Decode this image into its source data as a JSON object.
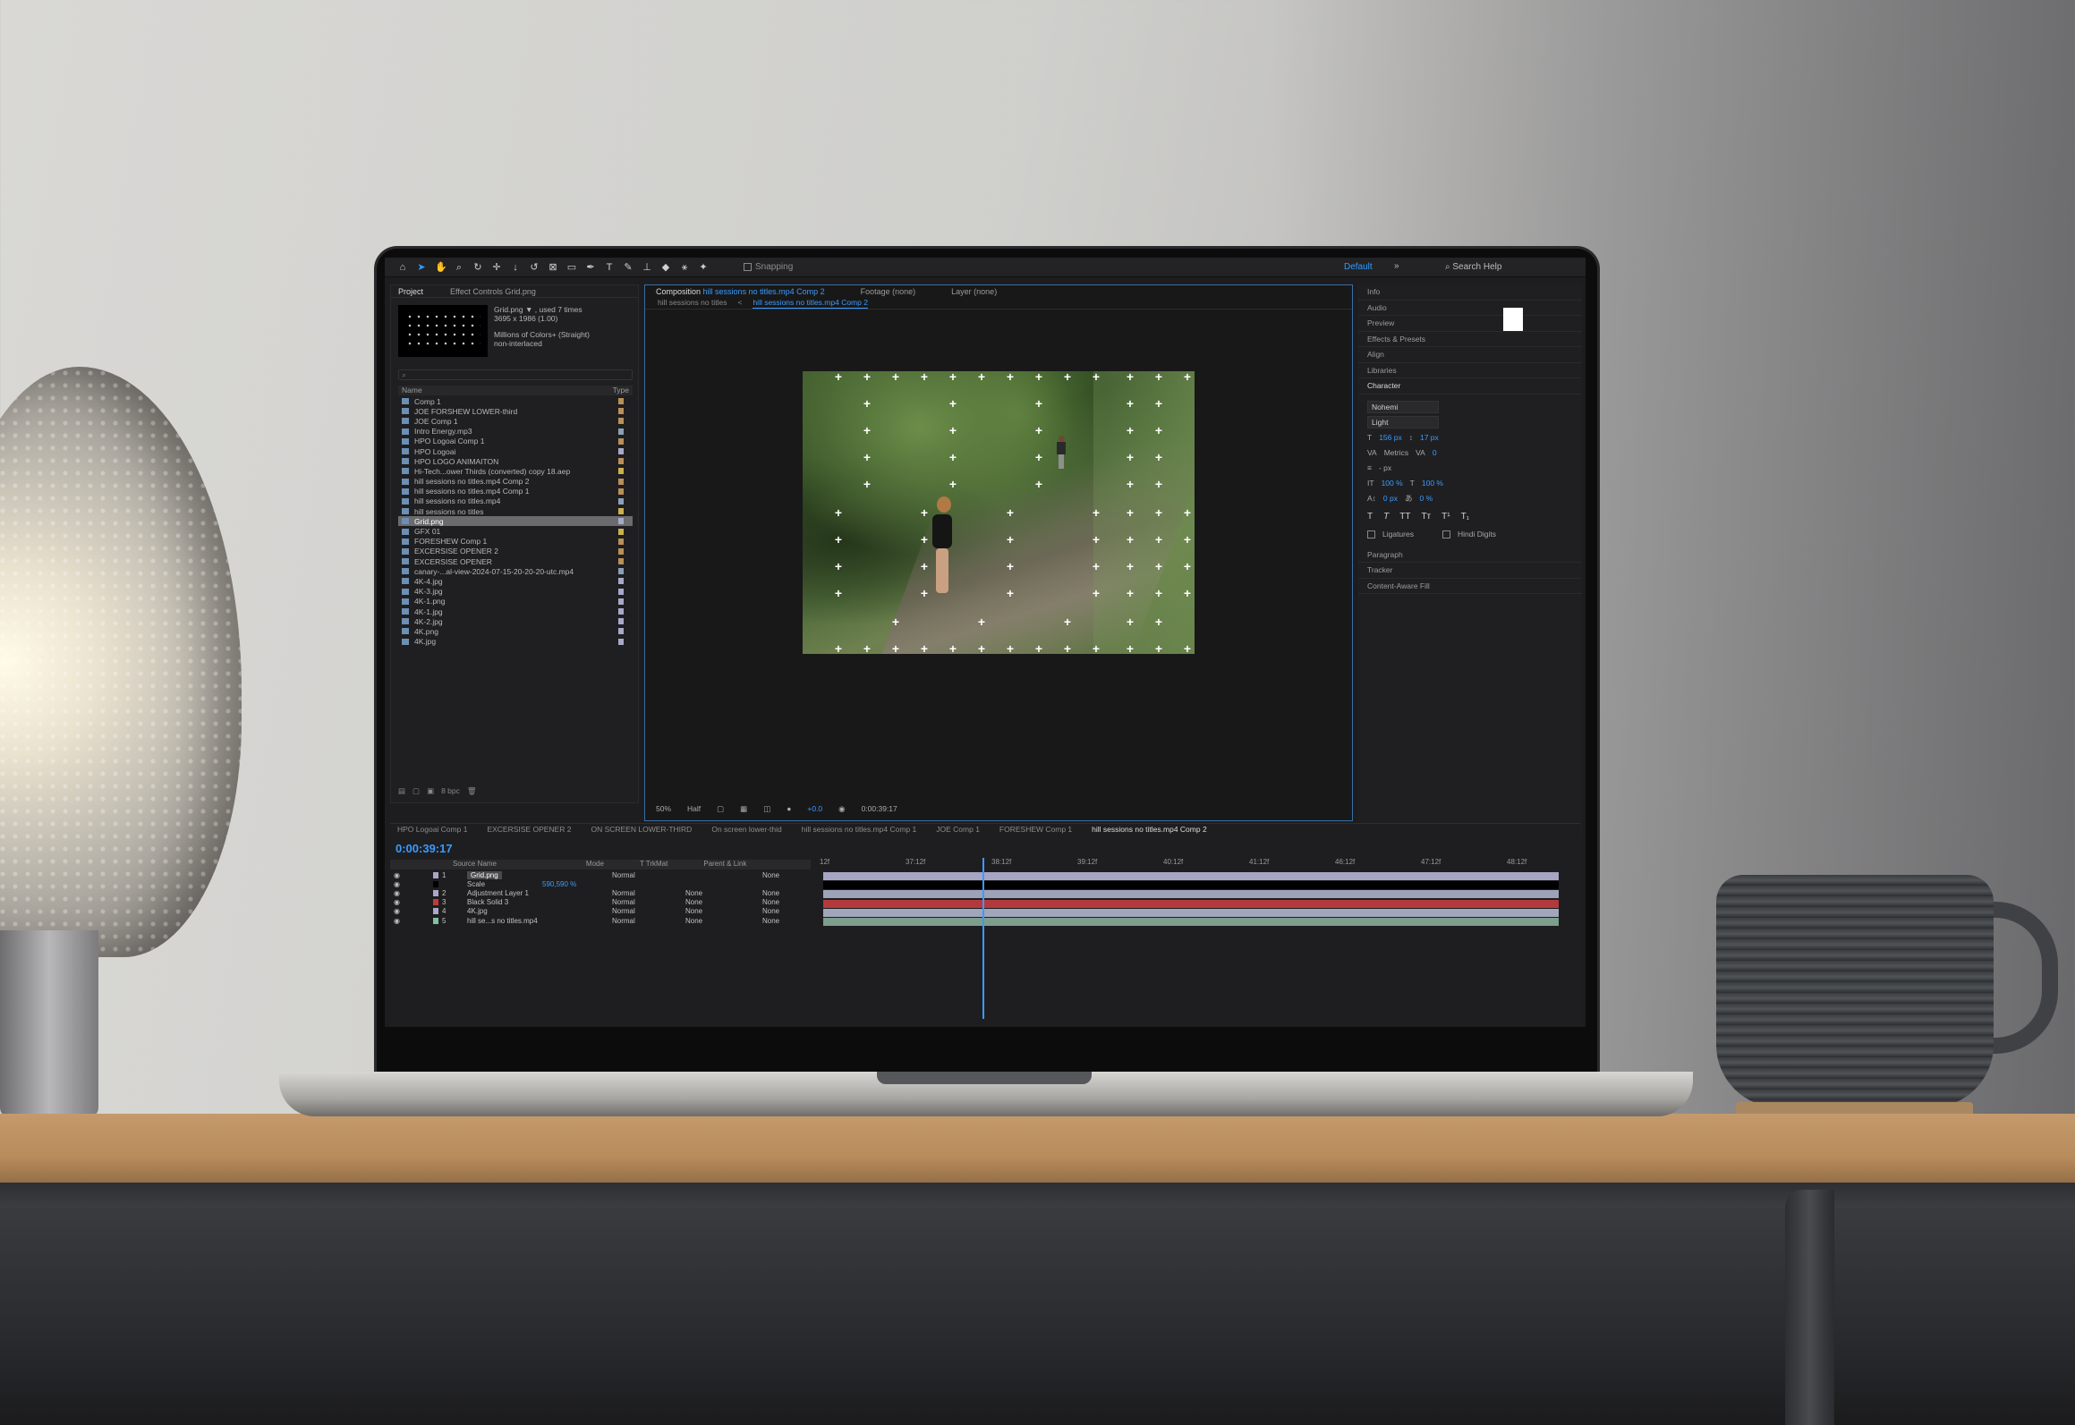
{
  "toolbar": {
    "snapping_label": "Snapping",
    "workspace": "Default",
    "search_help": "Search Help"
  },
  "project_panel": {
    "tab_project": "Project",
    "tab_effect_controls": "Effect Controls Grid.png",
    "info_line1": "Grid.png ▼ , used 7 times",
    "info_line2": "3695 x 1986 (1.00)",
    "info_line3": "Millions of Colors+ (Straight)",
    "info_line4": "non-interlaced",
    "col_name": "Name",
    "col_type": "Type",
    "items": [
      {
        "name": "Comp 1",
        "swatch": "#b98f5a"
      },
      {
        "name": "JOE FORSHEW LOWER-third",
        "swatch": "#b98f5a"
      },
      {
        "name": "JOE Comp 1",
        "swatch": "#b98f5a"
      },
      {
        "name": "Intro Energy.mp3",
        "swatch": "#8aa0b8"
      },
      {
        "name": "HPO Logoai Comp 1",
        "swatch": "#b98f5a"
      },
      {
        "name": "HPO Logoai",
        "swatch": "#a8a8c8"
      },
      {
        "name": "HPO LOGO ANIMAITON",
        "swatch": "#b98f5a"
      },
      {
        "name": "Hi-Tech...ower Thirds (converted) copy 18.aep",
        "swatch": "#c9b24a"
      },
      {
        "name": "hill sessions no titles.mp4 Comp 2",
        "swatch": "#b98f5a"
      },
      {
        "name": "hill sessions no titles.mp4 Comp 1",
        "swatch": "#b98f5a"
      },
      {
        "name": "hill sessions no titles.mp4",
        "swatch": "#8aa0b8"
      },
      {
        "name": "hill sessions no titles",
        "swatch": "#c9b24a"
      },
      {
        "name": "Grid.png",
        "swatch": "#a8a8c8",
        "selected": true
      },
      {
        "name": "GFX 01",
        "swatch": "#c9b24a"
      },
      {
        "name": "FORESHEW Comp 1",
        "swatch": "#b98f5a"
      },
      {
        "name": "EXCERSISE OPENER 2",
        "swatch": "#b98f5a"
      },
      {
        "name": "EXCERSISE OPENER",
        "swatch": "#b98f5a"
      },
      {
        "name": "canary-...al-view-2024-07-15-20-20-20-utc.mp4",
        "swatch": "#8aa0b8"
      },
      {
        "name": "4K-4.jpg",
        "swatch": "#a8a8c8"
      },
      {
        "name": "4K-3.jpg",
        "swatch": "#a8a8c8"
      },
      {
        "name": "4K-1.png",
        "swatch": "#a8a8c8"
      },
      {
        "name": "4K-1.jpg",
        "swatch": "#a8a8c8"
      },
      {
        "name": "4K-2.jpg",
        "swatch": "#a8a8c8"
      },
      {
        "name": "4K.png",
        "swatch": "#a8a8c8"
      },
      {
        "name": "4K.jpg",
        "swatch": "#a8a8c8"
      }
    ],
    "footer_bpc": "8 bpc"
  },
  "composition": {
    "tab_comp": "Composition",
    "tab_comp_name": "hill sessions no titles.mp4 Comp 2",
    "tab_footage": "Footage (none)",
    "tab_layer": "Layer (none)",
    "crumb1": "hill sessions no titles",
    "crumb2": "hill sessions no titles.mp4 Comp 2",
    "zoom": "50%",
    "resolution": "Half",
    "exposure": "+0.0",
    "time": "0:00:39:17"
  },
  "right_panel": {
    "sections_top": [
      "Info",
      "Audio",
      "Preview",
      "Effects & Presets",
      "Align",
      "Libraries"
    ],
    "character": "Character",
    "font": "Nohemi",
    "weight": "Light",
    "font_size": "156 px",
    "leading": "17 px",
    "kerning": "Metrics",
    "tracking": "0",
    "stroke": "- px",
    "vscale": "100 %",
    "hscale": "100 %",
    "baseline": "0 px",
    "tsume": "0 %",
    "ligatures": "Ligatures",
    "hindi_digits": "Hindi Digits",
    "sections_bottom": [
      "Paragraph",
      "Tracker",
      "Content-Aware Fill"
    ]
  },
  "timeline": {
    "tabs": [
      "HPO Logoai Comp 1",
      "EXCERSISE OPENER 2",
      "ON SCREEN LOWER-THIRD",
      "On screen lower-thid",
      "hill sessions no titles.mp4 Comp 1",
      "JOE Comp 1",
      "FORESHEW Comp 1",
      "hill sessions no titles.mp4 Comp 2"
    ],
    "timecode": "0:00:39:17",
    "head_source": "Source Name",
    "head_mode": "Mode",
    "head_trkmat": "T  TrkMat",
    "head_parent": "Parent & Link",
    "ruler": [
      "12f",
      "37:12f",
      "38:12f",
      "39:12f",
      "40:12f",
      "41:12f",
      "46:12f",
      "47:12f",
      "48:12f"
    ],
    "layers": [
      {
        "num": "1",
        "name": "Grid.png",
        "mode": "Normal",
        "trkmat": "",
        "parent": "None",
        "color": "#a8a8c8",
        "selected": true
      },
      {
        "num": "",
        "name": "Scale",
        "mode": "",
        "trkmat": "",
        "parent": "",
        "color": "#000000",
        "sub_value": "590,590 %"
      },
      {
        "num": "2",
        "name": "Adjustment Layer 1",
        "mode": "Normal",
        "trkmat": "None",
        "parent": "None",
        "color": "#a8a8c8"
      },
      {
        "num": "3",
        "name": "Black Solid 3",
        "mode": "Normal",
        "trkmat": "None",
        "parent": "None",
        "color": "#c0393b"
      },
      {
        "num": "4",
        "name": "4K.jpg",
        "mode": "Normal",
        "trkmat": "None",
        "parent": "None",
        "color": "#a8a8c8"
      },
      {
        "num": "5",
        "name": "hill se...s no titles.mp4",
        "mode": "Normal",
        "trkmat": "None",
        "parent": "None",
        "color": "#7fc2a0"
      }
    ],
    "bar_colors": [
      "#a7a5c4",
      "#000000",
      "#9da2b9",
      "#b23a3d",
      "#a2a6bb",
      "#7d9e8c"
    ]
  }
}
